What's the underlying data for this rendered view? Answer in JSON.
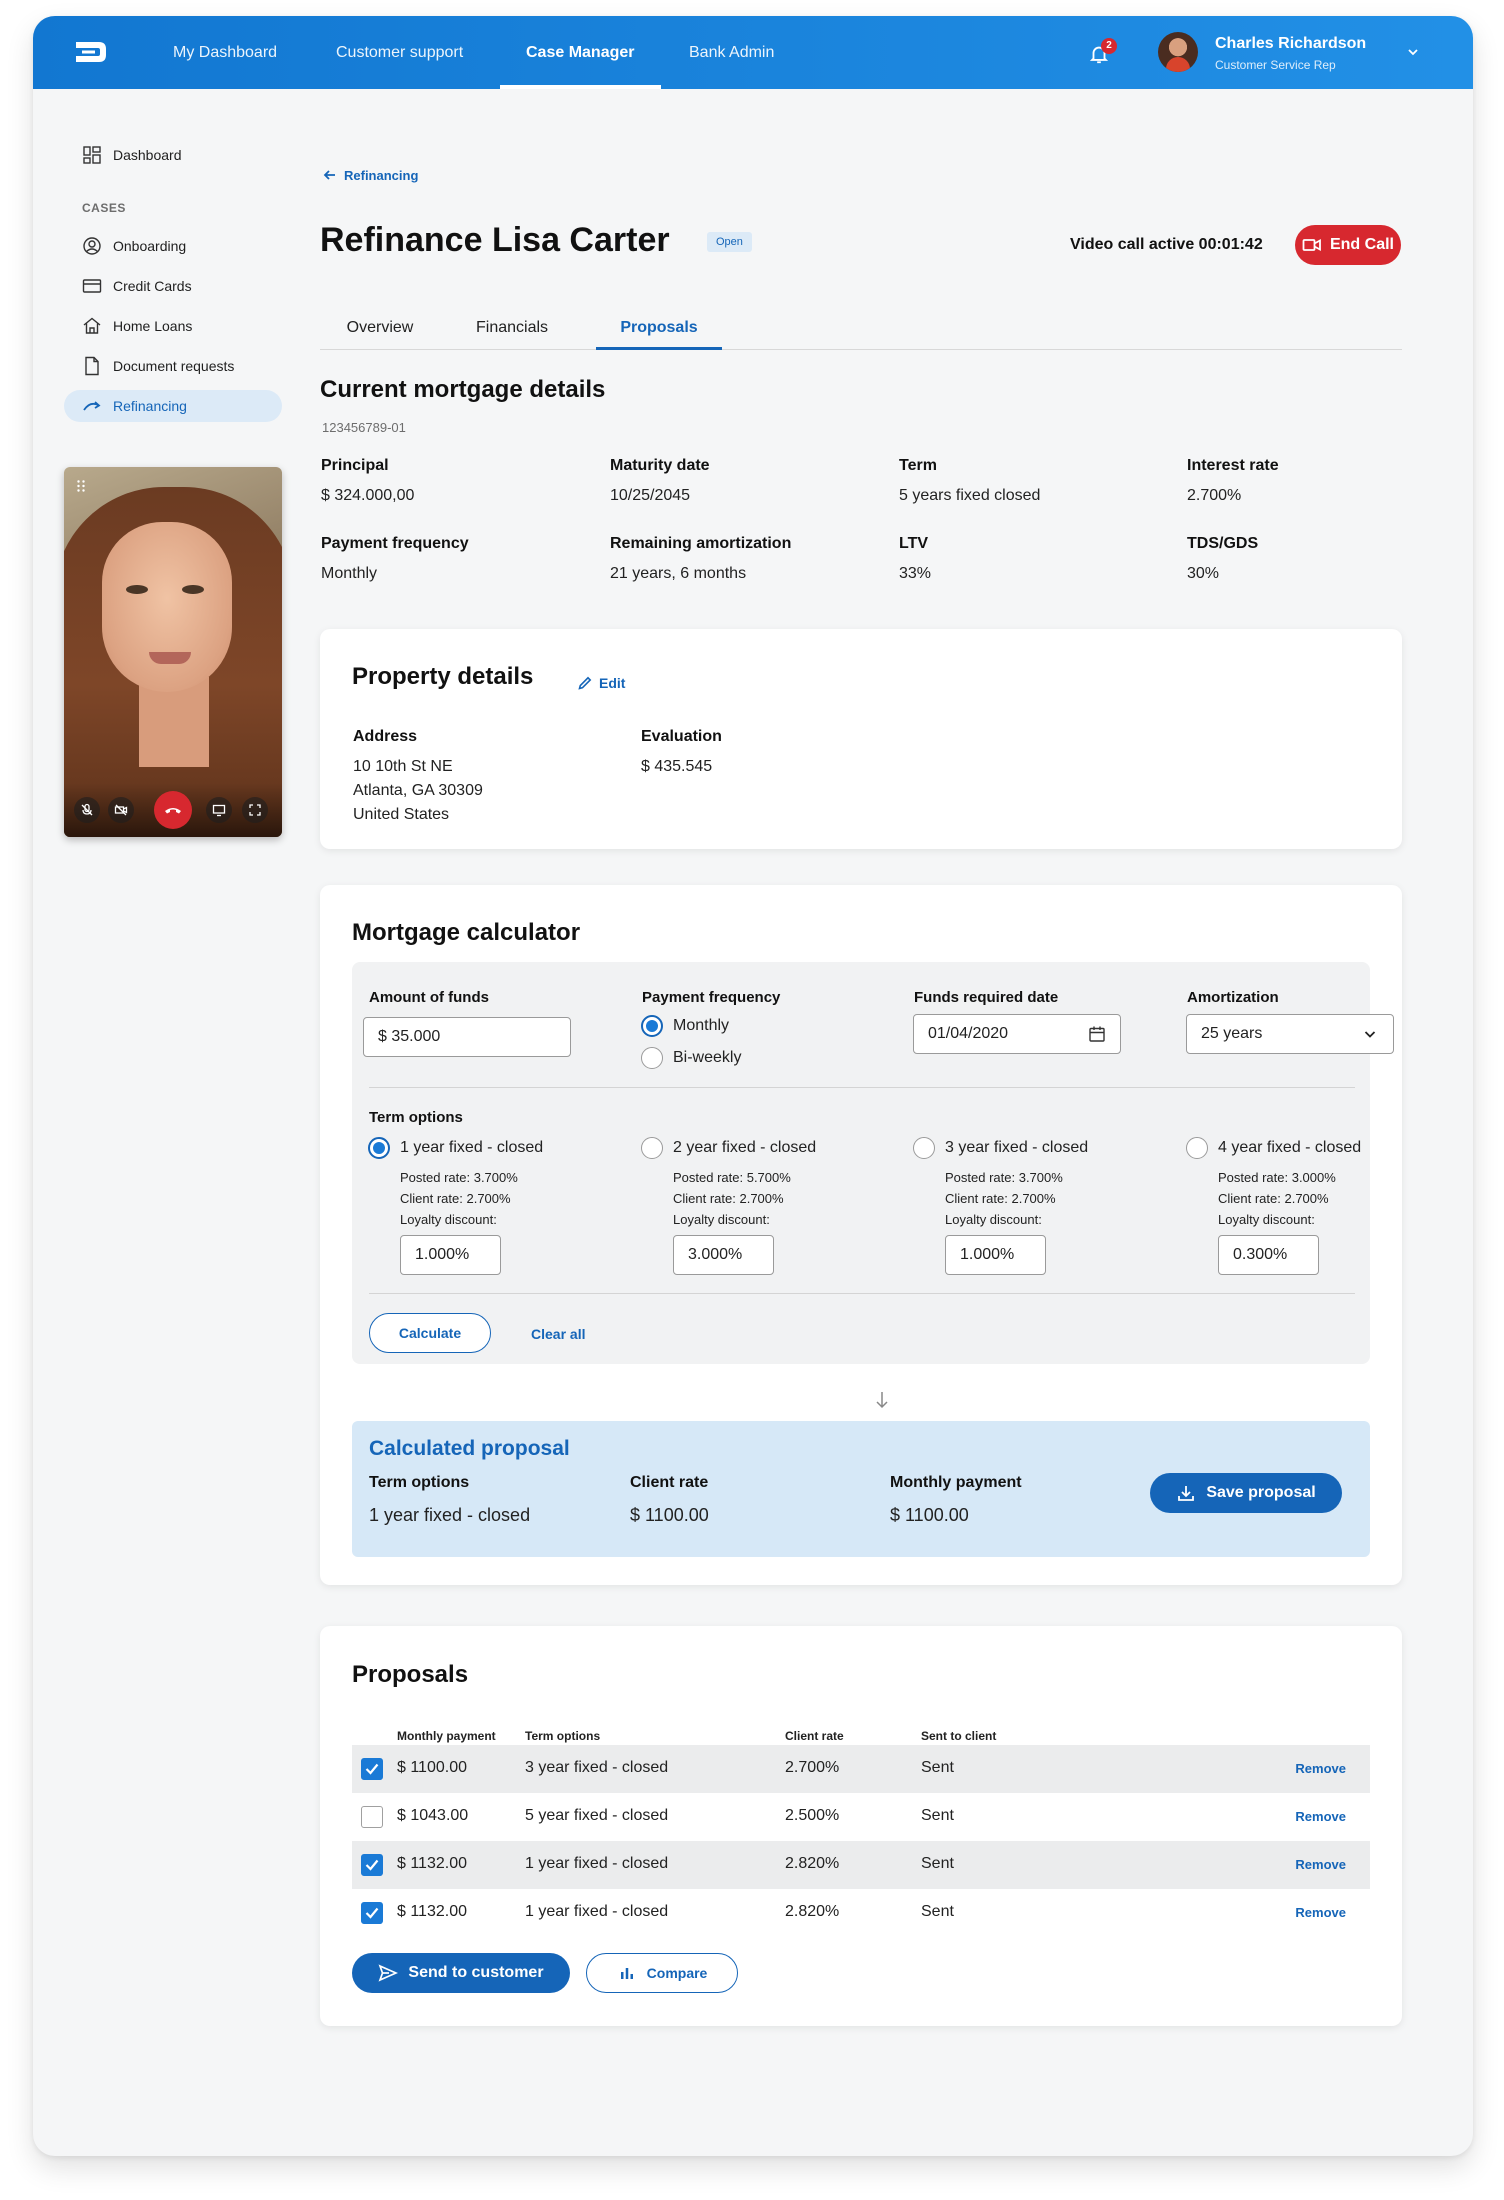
{
  "nav": {
    "items": [
      {
        "label": "My Dashboard",
        "active": false
      },
      {
        "label": "Customer support",
        "active": false
      },
      {
        "label": "Case Manager",
        "active": true
      },
      {
        "label": "Bank Admin",
        "active": false
      }
    ],
    "notifications": "2",
    "user": {
      "name": "Charles Richardson",
      "role": "Customer Service Rep"
    }
  },
  "sidebar": {
    "dashboard": "Dashboard",
    "heading": "CASES",
    "items": [
      {
        "label": "Onboarding",
        "icon": "user-circle-icon"
      },
      {
        "label": "Credit Cards",
        "icon": "credit-card-icon"
      },
      {
        "label": "Home Loans",
        "icon": "home-icon"
      },
      {
        "label": "Document requests",
        "icon": "document-icon"
      },
      {
        "label": "Refinancing",
        "icon": "refinance-icon",
        "active": true
      }
    ]
  },
  "header": {
    "breadcrumb": "Refinancing",
    "title": "Refinance Lisa Carter",
    "status": "Open",
    "video_status": "Video call active 00:01:42",
    "end_call": "End Call",
    "tabs": [
      "Overview",
      "Financials",
      "Proposals"
    ],
    "active_tab": "Proposals"
  },
  "mortgage": {
    "title": "Current mortgage details",
    "id": "123456789-01",
    "fields": [
      {
        "label": "Principal",
        "value": "$ 324.000,00"
      },
      {
        "label": "Maturity date",
        "value": "10/25/2045"
      },
      {
        "label": "Term",
        "value": "5 years fixed closed"
      },
      {
        "label": "Interest rate",
        "value": "2.700%"
      },
      {
        "label": "Payment frequency",
        "value": "Monthly"
      },
      {
        "label": "Remaining amortization",
        "value": "21 years, 6 months"
      },
      {
        "label": "LTV",
        "value": "33%"
      },
      {
        "label": "TDS/GDS",
        "value": "30%"
      }
    ]
  },
  "property": {
    "title": "Property details",
    "edit": "Edit",
    "address_label": "Address",
    "address_lines": [
      "10 10th St NE",
      "Atlanta, GA 30309",
      "United States"
    ],
    "evaluation_label": "Evaluation",
    "evaluation": "$ 435.545"
  },
  "calculator": {
    "title": "Mortgage calculator",
    "funds_label": "Amount of funds",
    "funds_value": "$ 35.000",
    "frequency_label": "Payment frequency",
    "frequency_options": [
      "Monthly",
      "Bi-weekly"
    ],
    "frequency_selected": "Monthly",
    "date_label": "Funds required date",
    "date_value": "01/04/2020",
    "amort_label": "Amortization",
    "amort_value": "25 years",
    "term_label": "Term options",
    "terms": [
      {
        "label": "1 year fixed - closed",
        "posted": "Posted rate: 3.700%",
        "client": "Client rate: 2.700%",
        "loyalty_label": "Loyalty discount:",
        "discount": "1.000%",
        "selected": true
      },
      {
        "label": "2 year fixed - closed",
        "posted": "Posted rate: 5.700%",
        "client": "Client rate: 2.700%",
        "loyalty_label": "Loyalty discount:",
        "discount": "3.000%",
        "selected": false
      },
      {
        "label": "3 year fixed - closed",
        "posted": "Posted rate: 3.700%",
        "client": "Client rate: 2.700%",
        "loyalty_label": "Loyalty discount:",
        "discount": "1.000%",
        "selected": false
      },
      {
        "label": "4 year fixed - closed",
        "posted": "Posted rate: 3.000%",
        "client": "Client rate: 2.700%",
        "loyalty_label": "Loyalty discount:",
        "discount": "0.300%",
        "selected": false
      }
    ],
    "calculate": "Calculate",
    "clear": "Clear all"
  },
  "proposal": {
    "title": "Calculated proposal",
    "term_label": "Term options",
    "term_value": "1 year fixed - closed",
    "rate_label": "Client rate",
    "rate_value": "$ 1100.00",
    "payment_label": "Monthly payment",
    "payment_value": "$ 1100.00",
    "save": "Save proposal"
  },
  "proposals": {
    "title": "Proposals",
    "columns": [
      "Monthly payment",
      "Term options",
      "Client rate",
      "Sent to client"
    ],
    "rows": [
      {
        "checked": true,
        "payment": "$ 1100.00",
        "term": "3 year fixed - closed",
        "rate": "2.700%",
        "sent": "Sent",
        "action": "Remove"
      },
      {
        "checked": false,
        "payment": "$ 1043.00",
        "term": "5 year fixed - closed",
        "rate": "2.500%",
        "sent": "Sent",
        "action": "Remove"
      },
      {
        "checked": true,
        "payment": "$ 1132.00",
        "term": "1 year fixed - closed",
        "rate": "2.820%",
        "sent": "Sent",
        "action": "Remove"
      },
      {
        "checked": true,
        "payment": "$ 1132.00",
        "term": "1 year fixed - closed",
        "rate": "2.820%",
        "sent": "Sent",
        "action": "Remove"
      }
    ],
    "send": "Send to customer",
    "compare": "Compare"
  },
  "colors": {
    "primary": "#1565b8",
    "nav": "#1a84de",
    "danger": "#d7282f",
    "highlight": "#d6e8f7"
  }
}
